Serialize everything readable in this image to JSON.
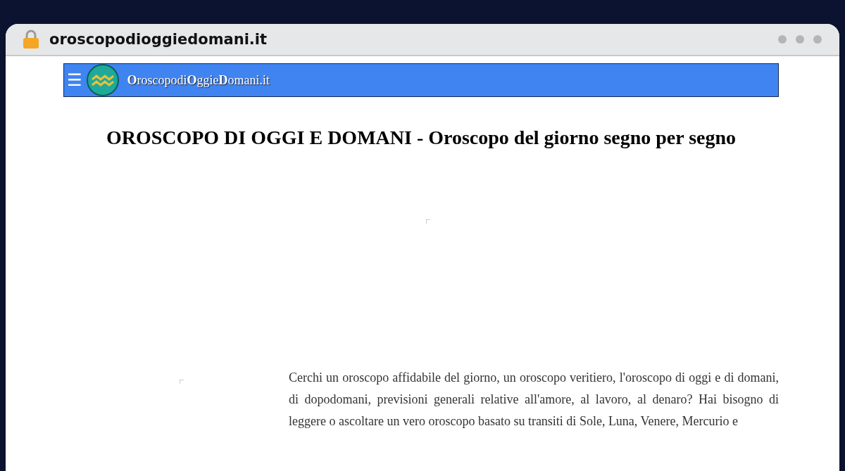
{
  "browser": {
    "url": "oroscopodioggiedomani.it"
  },
  "navbar": {
    "menu_icon": "☰",
    "site_name": "**O**roscopodi**O**ggie**D**omani.it"
  },
  "title": "OROSCOPO DI OGGI E DOMANI - Oroscopo del giorno segno per segno",
  "intro": "Cerchi un oroscopo affidabile del giorno, un oroscopo veritiero, l'oroscopo di oggi e di domani, di dopodomani, previsioni generali relative all'amore, al lavoro, al denaro? Hai bisogno di leggere o ascoltare un vero oroscopo basato su transiti di Sole, Luna, Venere, Mercurio e"
}
